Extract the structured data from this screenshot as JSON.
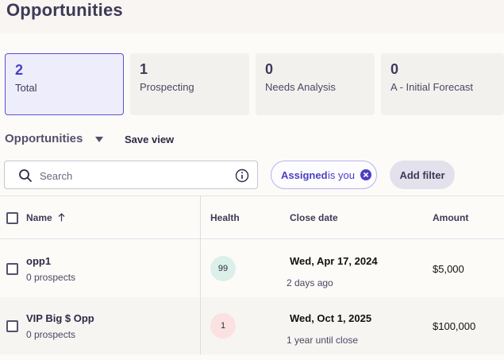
{
  "page": {
    "title": "Opportunities"
  },
  "summary_cards": [
    {
      "count": "2",
      "label": "Total",
      "active": true
    },
    {
      "count": "1",
      "label": "Prospecting",
      "active": false
    },
    {
      "count": "0",
      "label": "Needs Analysis",
      "active": false
    },
    {
      "count": "0",
      "label": "A - Initial Forecast",
      "active": false
    }
  ],
  "view": {
    "name": "Opportunities",
    "save_label": "Save view"
  },
  "search": {
    "placeholder": "Search",
    "value": ""
  },
  "filter_chip": {
    "field": "Assigned",
    "rest": "is you"
  },
  "add_filter_label": "Add filter",
  "table": {
    "columns": {
      "name": "Name",
      "health": "Health",
      "close_date": "Close date",
      "amount": "Amount"
    },
    "rows": [
      {
        "name": "opp1",
        "prospects": "0 prospects",
        "health": "99",
        "close_date": "Wed, Apr 17, 2024",
        "relative": "2 days ago",
        "amount": "$5,000"
      },
      {
        "name": "VIP Big $ Opp",
        "prospects": "0 prospects",
        "health": "1",
        "close_date": "Wed, Oct 1, 2025",
        "relative": "1 year until close",
        "amount": "$100,000"
      }
    ]
  },
  "colors": {
    "accent": "#4b3fc4",
    "health_good": "#dcf0ea",
    "health_bad": "#fbe1e1"
  }
}
